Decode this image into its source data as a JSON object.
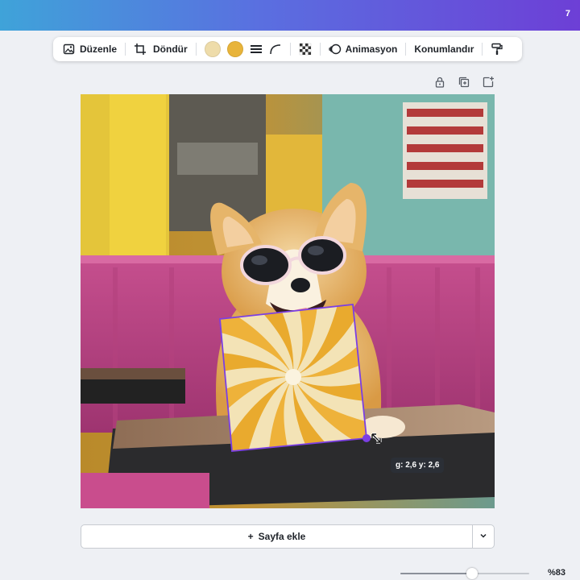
{
  "topbar": {
    "counter": "7",
    "gradient_start": "#3fa3d9",
    "gradient_end": "#6d3fd6"
  },
  "toolbar": {
    "edit_label": "Düzenle",
    "rotate_label": "Döndür",
    "color_swatches": [
      "#eedcaa",
      "#e8b43a"
    ],
    "animate_label": "Animasyon",
    "position_label": "Konumlandır"
  },
  "selection": {
    "dimensions_label": "g: 2,6 y: 2,6",
    "color": "#7b3fe4"
  },
  "canvas": {
    "scene": "corgi-with-sunglasses-in-diner",
    "element": "sunburst-swirl-graphic"
  },
  "add_page": {
    "label": "Sayfa ekle",
    "plus": "+"
  },
  "zoom": {
    "label": "%83",
    "level": 0.83
  }
}
